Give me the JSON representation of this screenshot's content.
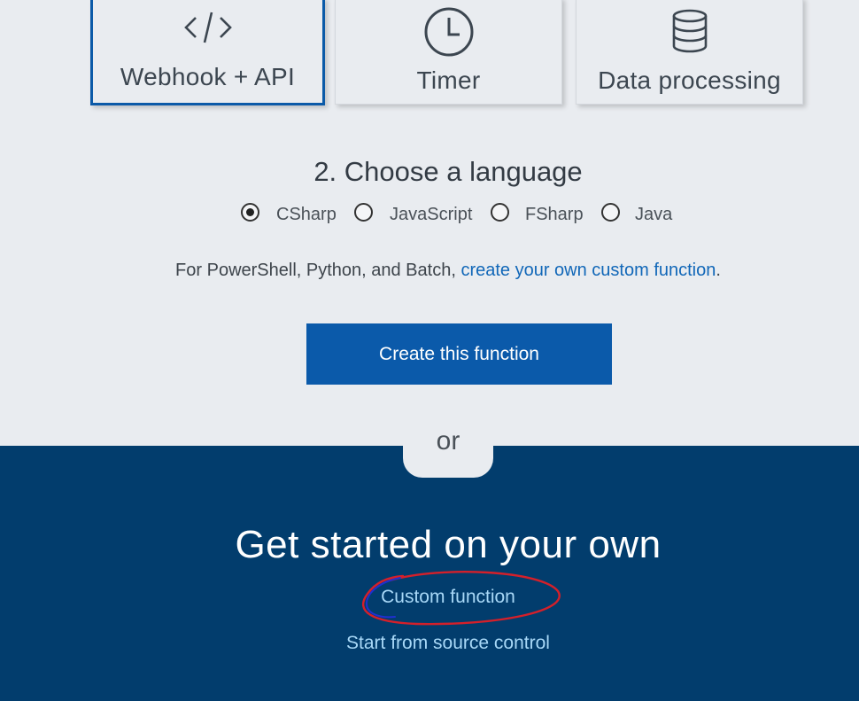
{
  "scenarios": [
    {
      "label": "Webhook + API",
      "icon": "code-brackets-icon",
      "selected": true
    },
    {
      "label": "Timer",
      "icon": "clock-icon",
      "selected": false
    },
    {
      "label": "Data processing",
      "icon": "database-icon",
      "selected": false
    }
  ],
  "language_section": {
    "title": "2. Choose a language",
    "options": [
      {
        "label": "CSharp",
        "checked": true
      },
      {
        "label": "JavaScript",
        "checked": false
      },
      {
        "label": "FSharp",
        "checked": false
      },
      {
        "label": "Java",
        "checked": false
      }
    ],
    "info_prefix": "For PowerShell, Python, and Batch, ",
    "info_link": "create your own custom function",
    "info_suffix": "."
  },
  "create_button_label": "Create this function",
  "divider_label": "or",
  "own_section": {
    "title": "Get started on your own",
    "links": {
      "custom_function": "Custom function",
      "source_control": "Start from source control"
    }
  },
  "colors": {
    "accent": "#0b5aaa",
    "dark_panel": "#023d6d",
    "link": "#1167b8",
    "panel_link": "#a8d8f7",
    "annotation_red": "#d4202a",
    "annotation_blue": "#2030d0"
  }
}
